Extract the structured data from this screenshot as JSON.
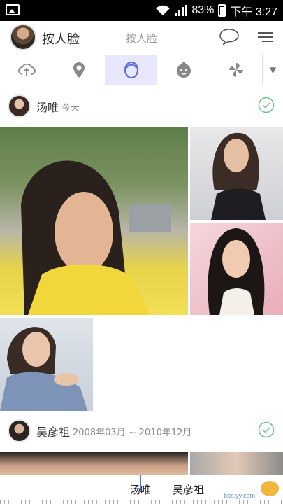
{
  "status": {
    "battery": "83%",
    "clock": "下午 3:27"
  },
  "header": {
    "title": "按人脸",
    "center_label": "按人脸",
    "icons": [
      "comment-icon",
      "menu-icon"
    ]
  },
  "tabs": [
    {
      "icon": "cloud-upload-icon",
      "active": false
    },
    {
      "icon": "location-pin-icon",
      "active": false
    },
    {
      "icon": "face-icon",
      "active": true
    },
    {
      "icon": "baby-face-icon",
      "active": false
    },
    {
      "icon": "pinwheel-icon",
      "active": false
    }
  ],
  "groups": [
    {
      "name": "汤唯",
      "date": "今天",
      "checked": true
    },
    {
      "name": "吴彦祖",
      "date": "2008年03月 ~ 2010年12月",
      "checked": true
    }
  ],
  "bottombar": {
    "names": [
      "汤唯",
      "吴彦祖"
    ],
    "watermark": "bbs.yy.com"
  },
  "colors": {
    "accent": "#5b6fd8",
    "active_tab_bg": "#e9e7fb",
    "check": "#6cc28a"
  }
}
